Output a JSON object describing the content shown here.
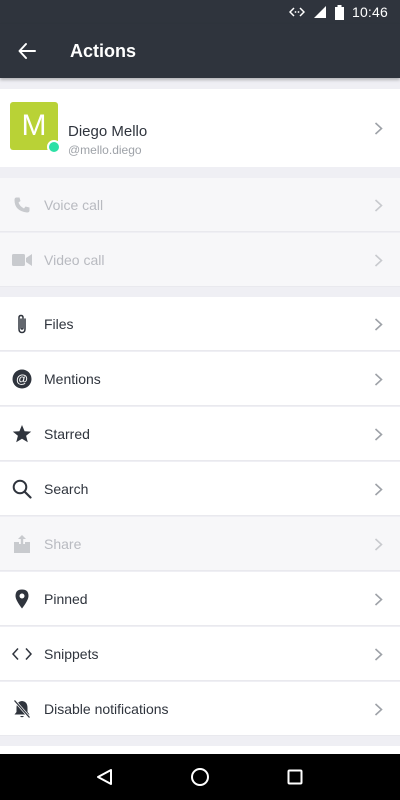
{
  "status_bar": {
    "time": "10:46",
    "icons": [
      "data-sync-icon",
      "signal-icon",
      "battery-icon"
    ]
  },
  "app_bar": {
    "title": "Actions",
    "back_icon": "arrow-left-icon"
  },
  "profile": {
    "avatar_letter": "M",
    "avatar_color": "#b9d236",
    "status_color": "#2de0a5",
    "name": "Diego Mello",
    "username": "@mello.diego"
  },
  "actions": [
    {
      "label": "Voice call",
      "icon": "phone-icon",
      "enabled": false
    },
    {
      "label": "Video call",
      "icon": "video-camera-icon",
      "enabled": false
    },
    {
      "label": "Files",
      "icon": "paperclip-icon",
      "enabled": true
    },
    {
      "label": "Mentions",
      "icon": "at-sign-icon",
      "enabled": true
    },
    {
      "label": "Starred",
      "icon": "star-icon",
      "enabled": true
    },
    {
      "label": "Search",
      "icon": "search-icon",
      "enabled": true
    },
    {
      "label": "Share",
      "icon": "share-icon",
      "enabled": false
    },
    {
      "label": "Pinned",
      "icon": "pin-icon",
      "enabled": true
    },
    {
      "label": "Snippets",
      "icon": "code-icon",
      "enabled": true
    },
    {
      "label": "Disable notifications",
      "icon": "bell-off-icon",
      "enabled": true
    }
  ],
  "nav_bar": {
    "icons": [
      "nav-back-icon",
      "nav-home-icon",
      "nav-recents-icon"
    ]
  },
  "colors": {
    "header": "#2f343d",
    "background": "#efeff4",
    "text": "#2f343d",
    "disabled_text": "#b8bac0",
    "secondary_text": "#9ea2a8"
  }
}
